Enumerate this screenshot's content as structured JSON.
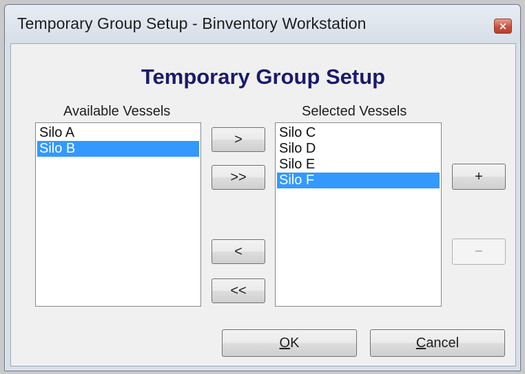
{
  "window": {
    "title": "Temporary Group Setup - Binventory Workstation",
    "close_label": "×"
  },
  "dialog": {
    "heading": "Temporary Group Setup",
    "available": {
      "label": "Available Vessels",
      "items": [
        {
          "label": "Silo A",
          "selected": false
        },
        {
          "label": "Silo B",
          "selected": true
        }
      ]
    },
    "selected": {
      "label": "Selected Vessels",
      "items": [
        {
          "label": "Silo C",
          "selected": false
        },
        {
          "label": "Silo D",
          "selected": false
        },
        {
          "label": "Silo E",
          "selected": false
        },
        {
          "label": "Silo F",
          "selected": true
        }
      ]
    },
    "buttons": {
      "move_right": ">",
      "move_all_right": ">>",
      "move_left": "<",
      "move_all_left": "<<",
      "add": "+",
      "remove": "−",
      "ok_mnemonic": "O",
      "ok_rest": "K",
      "cancel_mnemonic": "C",
      "cancel_rest": "ancel"
    }
  },
  "colors": {
    "heading": "#1a1a6e",
    "selection": "#3399ff"
  }
}
